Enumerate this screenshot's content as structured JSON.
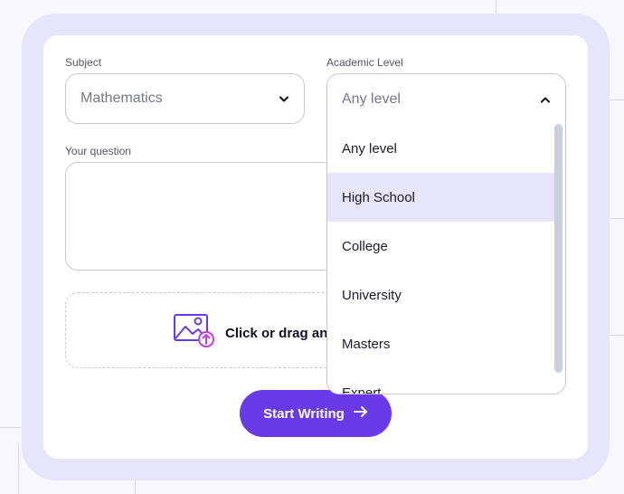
{
  "form": {
    "subject_label": "Subject",
    "subject_value": "Mathematics",
    "level_label": "Academic Level",
    "level_value": "Any level",
    "question_label": "Your question",
    "question_value": "",
    "upload_text": "Click or drag an",
    "submit_label": "Start Writing"
  },
  "level_options": [
    "Any level",
    "High School",
    "College",
    "University",
    "Masters",
    "Expert"
  ],
  "highlighted_option": "High School",
  "icons": {
    "subject_chevron": "chevron-down-icon",
    "level_chevron": "chevron-up-icon",
    "upload": "image-upload-icon",
    "submit_arrow": "arrow-right-icon"
  },
  "colors": {
    "accent": "#6a3ae8",
    "highlight": "#e6e5fb",
    "frame": "#e6e5fb"
  }
}
